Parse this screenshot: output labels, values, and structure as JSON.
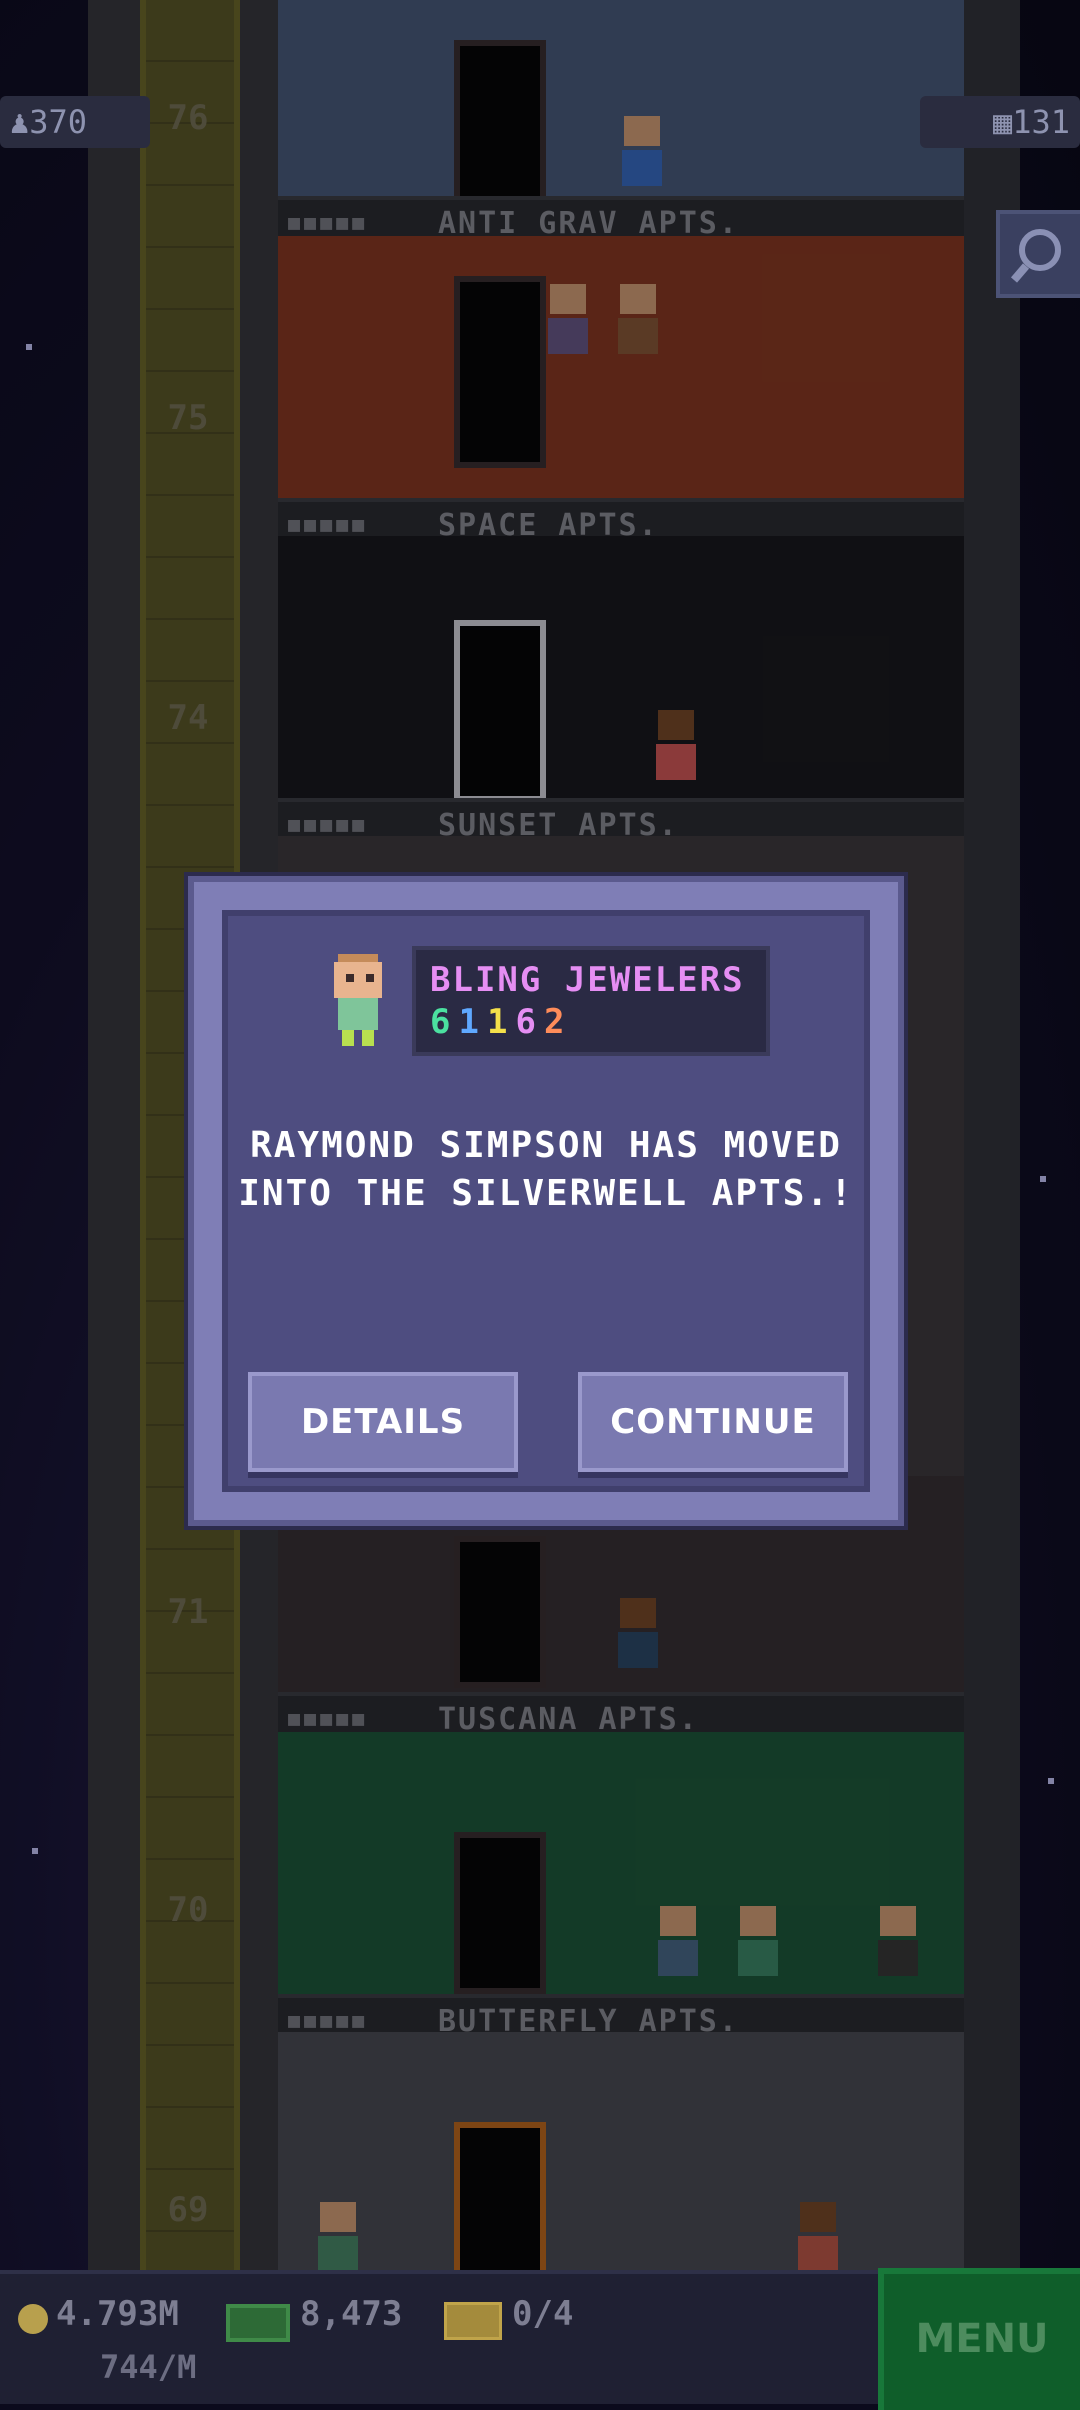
{
  "hud": {
    "population": "370",
    "population_icon": "person-icon",
    "top_floor_number": "76",
    "floors_count": "131",
    "floors_icon": "building-icon",
    "search_icon": "magnifier-icon"
  },
  "floors": [
    {
      "number": "",
      "name": "ANTI GRAV APTS.",
      "color": "#4a5c7e"
    },
    {
      "number": "75",
      "name": "SPACE APTS.",
      "color": "#8a3a24"
    },
    {
      "number": "74",
      "name": "SUNSET APTS.",
      "color": "#1a1a1f"
    },
    {
      "number": "71",
      "name": "TUSCANA APTS.",
      "color": "#3a3236"
    },
    {
      "number": "70",
      "name": "BUTTERFLY APTS.",
      "color": "#1e5a3c"
    },
    {
      "number": "69",
      "name": "",
      "color": "#4c4e56"
    }
  ],
  "dialog": {
    "store_name": "BLING JEWELERS",
    "store_code_digits": [
      "6",
      "1",
      "1",
      "6",
      "2"
    ],
    "store_code_colors": [
      "#4be0a0",
      "#5fa8ff",
      "#f4e04a",
      "#e58ef3",
      "#ff8c5a"
    ],
    "message": "RAYMOND SIMPSON HAS MOVED INTO THE SILVERWELL APTS.!",
    "details_label": "DETAILS",
    "continue_label": "CONTINUE"
  },
  "bottom": {
    "coins": "4.793M",
    "coin_rate": "744/M",
    "bux": "8,473",
    "tickets": "0/4",
    "menu_label": "MENU",
    "coin_icon": "coin-icon",
    "bux_icon": "tower-bux-icon",
    "ticket_icon": "ticket-icon"
  }
}
